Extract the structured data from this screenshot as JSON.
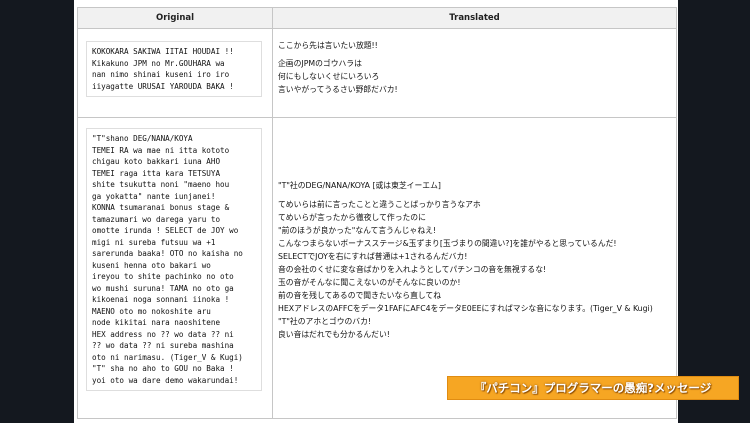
{
  "table": {
    "headers": [
      "Original",
      "Translated"
    ],
    "row1": {
      "original": "KOKOKARA SAKIWA IITAI HOUDAI !!\nKikakuno JPM no Mr.GOUHARA wa\nnan nimo shinai kuseni iro iro\niiyagatte URUSAI YAROUDA BAKA !",
      "translated": [
        "ここから先は言いたい放題!!",
        "企画のJPMのゴウハラは",
        "何にもしないくせにいろいろ",
        "言いやがってうるさい野郎だバカ!"
      ]
    },
    "row2": {
      "original": "\"T\"shano DEG/NANA/KOYA\nTEMEI RA wa mae ni itta kototo\nchigau koto bakkari iuna AHO\nTEMEI raga itta kara TETSUYA\nshite tsukutta noni \"maeno hou\nga yokatta\" nante iunjanei!\nKONNA tsumaranai bonus stage &\ntamazumari wo darega yaru to\nomotte irunda ! SELECT de JOY wo\nmigi ni sureba futsuu wa +1\nsarerunda baaka! OTO no kaisha no\nkuseni henna oto bakari wo\nireyou to shite pachinko no oto\nwo mushi suruna! TAMA no oto ga\nkikoenai noga sonnani iinoka !\nMAENO oto mo nokoshite aru\nnode kikitai nara naoshitene\nHEX address no ?? wo data ?? ni\n?? wo data ?? ni sureba mashina\noto ni narimasu. (Tiger_V & Kugi)\n\"T\" sha no aho to GOU no Baka !\nyoi oto wa dare demo wakarundai!",
      "translated_head": "\"T\"社のDEG/NANA/KOYA [或は東芝イーエム]",
      "translated": [
        "てめいらは前に言ったことと違うことばっかり言うなアホ",
        "てめいらが言ったから徹夜して作ったのに",
        "\"前のほうが良かった\"なんて言うんじゃねえ!",
        "こんなつまらないボーナスステージ&玉ずまり[玉づまりの間違い?]を誰がやると思っているんだ!",
        "SELECTでJOYを右にすれば普通は+1されるんだバカ!",
        "音の会社のくせに変な音ばかりを入れようとしてパチンコの音を無視するな!",
        "玉の音がそんなに聞こえないのがそんなに良いのか!",
        "前の音を残してあるので聞きたいなら直してね",
        "HEXアドレスのAFFCをデータ1FAFにAFC4をデータE0EEにすればマシな音になります。(Tiger_V & Kugi)",
        "\"T\"社のアホとゴウのバカ!",
        "良い音はだれでも分かるんだい!"
      ]
    }
  },
  "banner": "『パチコン』プログラマーの愚痴?メッセージ"
}
